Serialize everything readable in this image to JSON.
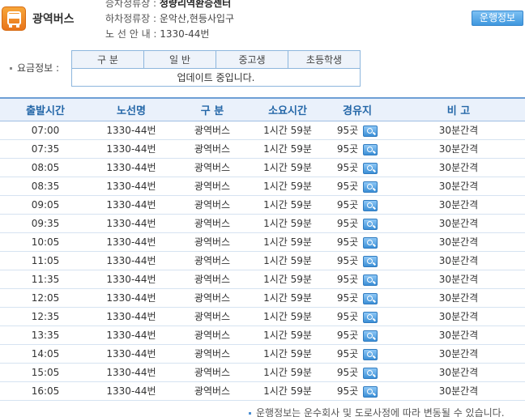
{
  "header": {
    "bus_type": "광역버스",
    "boarding_label": "승차정류장 : ",
    "boarding_value": "청량리역환승센터",
    "alighting_label": "하차정류장 : ",
    "alighting_value": "운악산,현등사입구",
    "route_label": "노 선 안 내 : ",
    "route_value": "1330-44번",
    "op_button": "운행정보"
  },
  "fare": {
    "label": "요금정보 :",
    "headers": [
      "구 분",
      "일 반",
      "중고생",
      "초등학생"
    ],
    "status": "업데이트 중입니다."
  },
  "schedule": {
    "headers": [
      "출발시간",
      "노선명",
      "구 분",
      "소요시간",
      "경유지",
      "비 고"
    ],
    "rows": [
      {
        "time": "07:00",
        "route": "1330-44번",
        "type": "광역버스",
        "duration": "1시간 59분",
        "stops": "95곳",
        "note": "30분간격"
      },
      {
        "time": "07:35",
        "route": "1330-44번",
        "type": "광역버스",
        "duration": "1시간 59분",
        "stops": "95곳",
        "note": "30분간격"
      },
      {
        "time": "08:05",
        "route": "1330-44번",
        "type": "광역버스",
        "duration": "1시간 59분",
        "stops": "95곳",
        "note": "30분간격"
      },
      {
        "time": "08:35",
        "route": "1330-44번",
        "type": "광역버스",
        "duration": "1시간 59분",
        "stops": "95곳",
        "note": "30분간격"
      },
      {
        "time": "09:05",
        "route": "1330-44번",
        "type": "광역버스",
        "duration": "1시간 59분",
        "stops": "95곳",
        "note": "30분간격"
      },
      {
        "time": "09:35",
        "route": "1330-44번",
        "type": "광역버스",
        "duration": "1시간 59분",
        "stops": "95곳",
        "note": "30분간격"
      },
      {
        "time": "10:05",
        "route": "1330-44번",
        "type": "광역버스",
        "duration": "1시간 59분",
        "stops": "95곳",
        "note": "30분간격"
      },
      {
        "time": "11:05",
        "route": "1330-44번",
        "type": "광역버스",
        "duration": "1시간 59분",
        "stops": "95곳",
        "note": "30분간격"
      },
      {
        "time": "11:35",
        "route": "1330-44번",
        "type": "광역버스",
        "duration": "1시간 59분",
        "stops": "95곳",
        "note": "30분간격"
      },
      {
        "time": "12:05",
        "route": "1330-44번",
        "type": "광역버스",
        "duration": "1시간 59분",
        "stops": "95곳",
        "note": "30분간격"
      },
      {
        "time": "12:35",
        "route": "1330-44번",
        "type": "광역버스",
        "duration": "1시간 59분",
        "stops": "95곳",
        "note": "30분간격"
      },
      {
        "time": "13:35",
        "route": "1330-44번",
        "type": "광역버스",
        "duration": "1시간 59분",
        "stops": "95곳",
        "note": "30분간격"
      },
      {
        "time": "14:05",
        "route": "1330-44번",
        "type": "광역버스",
        "duration": "1시간 59분",
        "stops": "95곳",
        "note": "30분간격"
      },
      {
        "time": "15:05",
        "route": "1330-44번",
        "type": "광역버스",
        "duration": "1시간 59분",
        "stops": "95곳",
        "note": "30분간격"
      },
      {
        "time": "16:05",
        "route": "1330-44번",
        "type": "광역버스",
        "duration": "1시간 59분",
        "stops": "95곳",
        "note": "30분간격"
      }
    ]
  },
  "notice": "운행정보는 운수회사 및 도로사정에 따라 변동될 수 있습니다.",
  "icons": {
    "bus": "bus-icon",
    "stops_detail": "search-icon"
  },
  "colors": {
    "header_text": "#2467a8",
    "button": "#3f97de",
    "bus_icon": "#e8741a"
  }
}
